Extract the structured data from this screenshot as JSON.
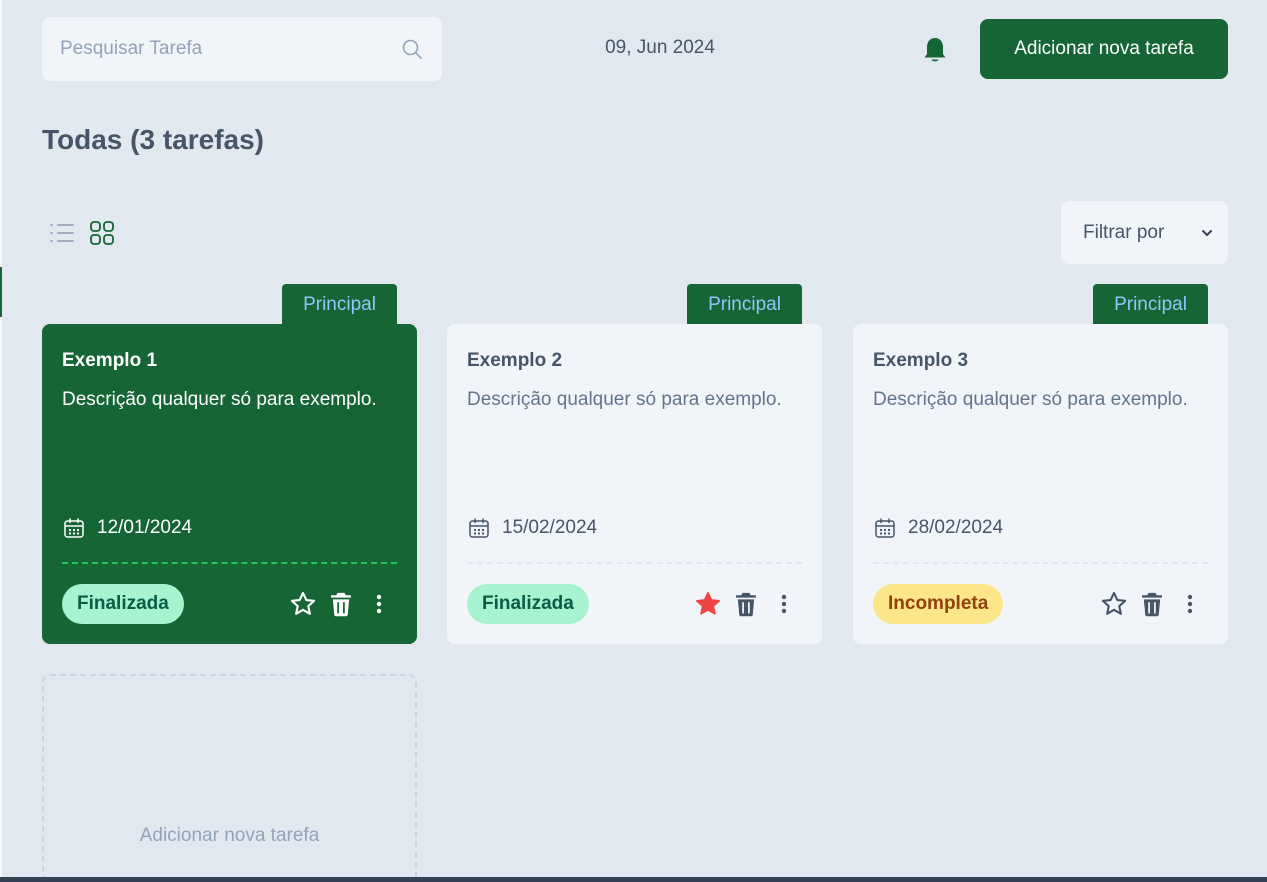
{
  "search": {
    "placeholder": "Pesquisar Tarefa"
  },
  "header": {
    "date": "09, Jun 2024",
    "add_button": "Adicionar nova tarefa"
  },
  "page": {
    "title": "Todas (3 tarefas)",
    "filter_label": "Filtrar por",
    "active_view": "grid"
  },
  "colors": {
    "brand": "#166534",
    "background": "#e2e8f0",
    "card": "#f1f5f9",
    "favorite": "#ef4444",
    "status_done": "#a7f3d0",
    "status_incomplete": "#fde68a",
    "tag_text": "#93c5fd"
  },
  "tasks": [
    {
      "tag": "Principal",
      "title": "Exemplo 1",
      "description": "Descrição qualquer só para exemplo.",
      "date": "12/01/2024",
      "status": "Finalizada",
      "favorite": false,
      "highlighted": true
    },
    {
      "tag": "Principal",
      "title": "Exemplo 2",
      "description": "Descrição qualquer só para exemplo.",
      "date": "15/02/2024",
      "status": "Finalizada",
      "favorite": true,
      "highlighted": false
    },
    {
      "tag": "Principal",
      "title": "Exemplo 3",
      "description": "Descrição qualquer só para exemplo.",
      "date": "28/02/2024",
      "status": "Incompleta",
      "favorite": false,
      "highlighted": false
    }
  ],
  "add_card": {
    "label": "Adicionar nova tarefa"
  }
}
